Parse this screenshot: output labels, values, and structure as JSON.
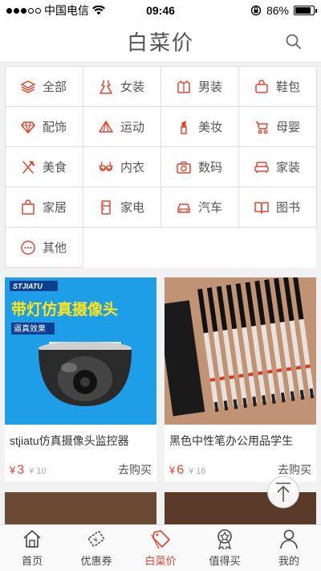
{
  "status_bar": {
    "carrier": "中国电信",
    "time": "09:46",
    "battery": "86%",
    "battery_level": 0.86
  },
  "header": {
    "title": "白菜价"
  },
  "categories": [
    {
      "label": "全部",
      "icon": "layers-icon"
    },
    {
      "label": "女装",
      "icon": "dress-icon"
    },
    {
      "label": "男装",
      "icon": "shirt-icon"
    },
    {
      "label": "鞋包",
      "icon": "bag-icon"
    },
    {
      "label": "配饰",
      "icon": "diamond-icon"
    },
    {
      "label": "运动",
      "icon": "tent-icon"
    },
    {
      "label": "美妆",
      "icon": "lipstick-icon"
    },
    {
      "label": "母婴",
      "icon": "stroller-icon"
    },
    {
      "label": "美食",
      "icon": "cutlery-icon"
    },
    {
      "label": "内衣",
      "icon": "bra-icon"
    },
    {
      "label": "数码",
      "icon": "camera-icon"
    },
    {
      "label": "家装",
      "icon": "sofa-icon"
    },
    {
      "label": "家居",
      "icon": "shopping-bag-icon"
    },
    {
      "label": "家电",
      "icon": "fridge-icon"
    },
    {
      "label": "汽车",
      "icon": "car-icon"
    },
    {
      "label": "图书",
      "icon": "book-icon"
    },
    {
      "label": "其他",
      "icon": "more-icon"
    }
  ],
  "products": [
    {
      "title": "stjiatu仿真摄像头监控器",
      "price": "3",
      "currency": "¥",
      "original": "¥ 10",
      "action": "去购买",
      "image_text": {
        "brand": "STJIATU",
        "headline": "带灯仿真摄像头",
        "badge": "逼真效果"
      }
    },
    {
      "title": "黑色中性笔办公用品学生",
      "price": "6",
      "currency": "¥",
      "original": "¥ 16",
      "action": "去购买"
    }
  ],
  "tabs": [
    {
      "label": "首页",
      "icon": "home-icon",
      "active": false
    },
    {
      "label": "优惠券",
      "icon": "coupon-icon",
      "active": false
    },
    {
      "label": "白菜价",
      "icon": "price-tag-icon",
      "active": true
    },
    {
      "label": "值得买",
      "icon": "medal-icon",
      "active": false
    },
    {
      "label": "我的",
      "icon": "user-icon",
      "active": false
    }
  ],
  "colors": {
    "accent": "#e5432d",
    "text": "#555555",
    "background": "#f2f2f2"
  }
}
